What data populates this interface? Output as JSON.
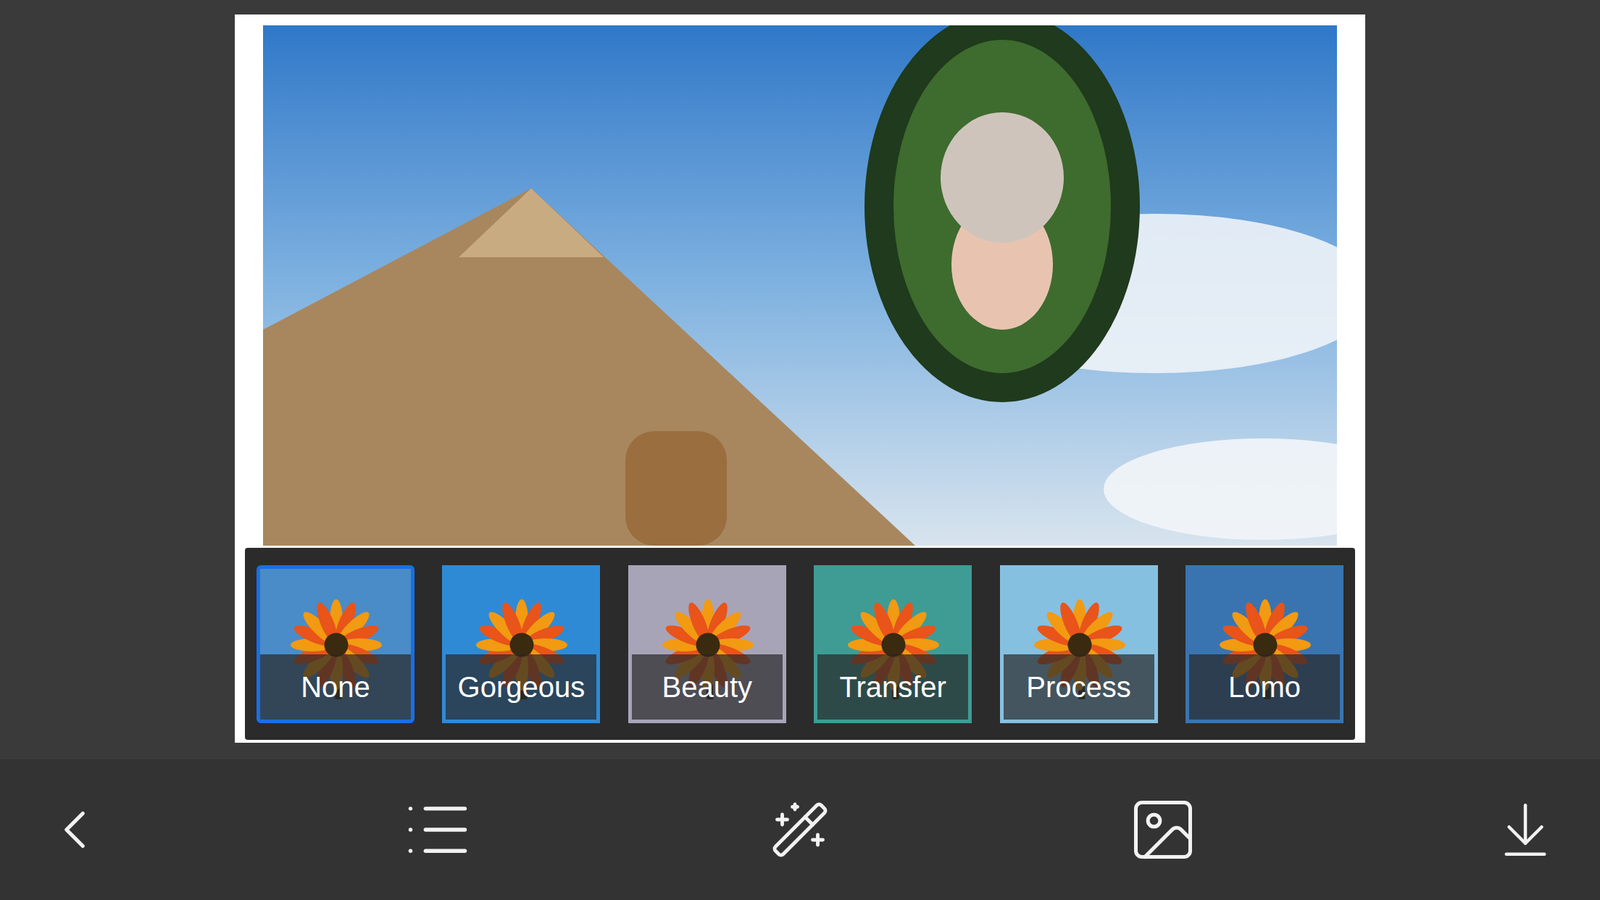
{
  "filters": [
    {
      "label": "None",
      "selected": true,
      "color": "#4a8cc8"
    },
    {
      "label": "Gorgeous",
      "selected": false,
      "color": "#2f8ad6"
    },
    {
      "label": "Beauty",
      "selected": false,
      "color": "#a8a4b8"
    },
    {
      "label": "Transfer",
      "selected": false,
      "color": "#3e9c94"
    },
    {
      "label": "Process",
      "selected": false,
      "color": "#86c0e0"
    },
    {
      "label": "Lomo",
      "selected": false,
      "color": "#3a74b0"
    }
  ]
}
